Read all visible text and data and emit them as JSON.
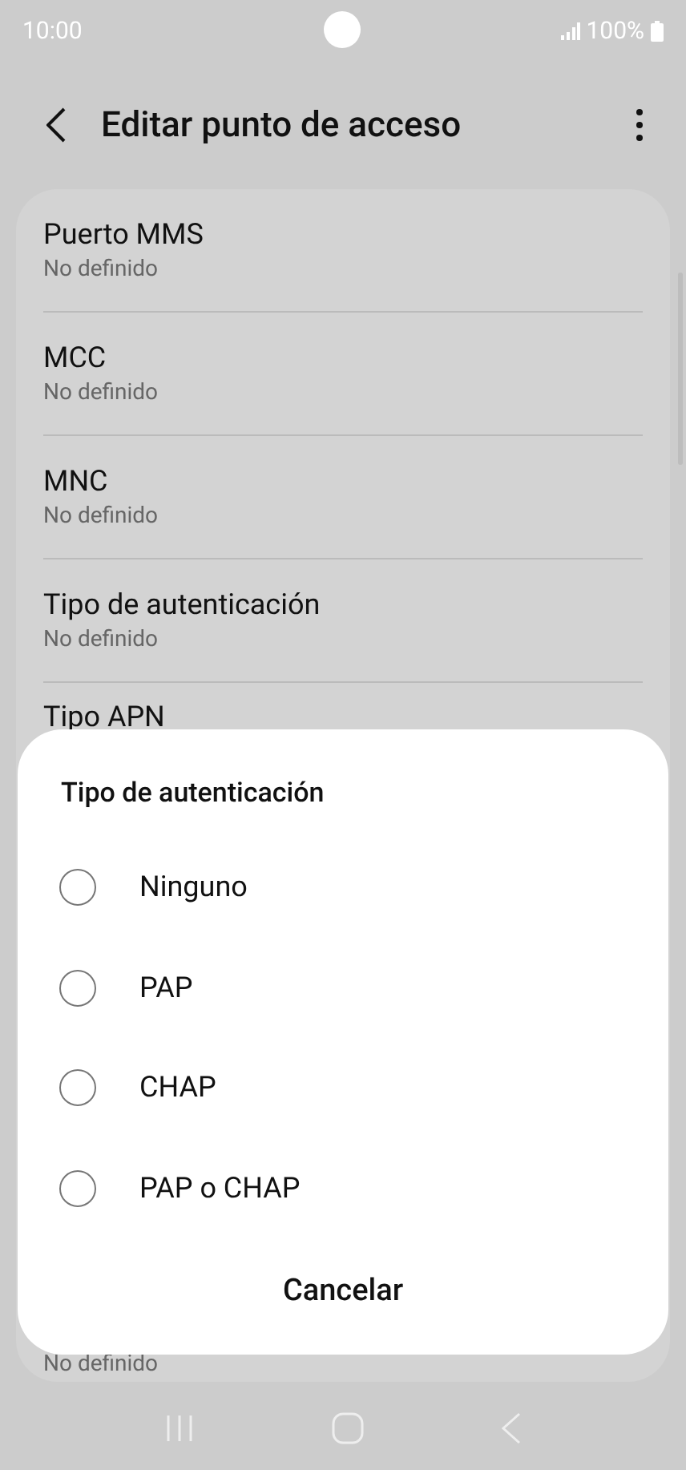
{
  "status_bar": {
    "time": "10:00",
    "battery": "100%"
  },
  "header": {
    "title": "Editar punto de acceso"
  },
  "settings": [
    {
      "title": "Puerto MMS",
      "subtitle": "No definido"
    },
    {
      "title": "MCC",
      "subtitle": "No definido"
    },
    {
      "title": "MNC",
      "subtitle": "No definido"
    },
    {
      "title": "Tipo de autenticación",
      "subtitle": "No definido"
    },
    {
      "title": "Tipo APN"
    }
  ],
  "last_setting": {
    "subtitle": "No definido"
  },
  "dialog": {
    "title": "Tipo de autenticación",
    "options": [
      {
        "label": "Ninguno",
        "selected": false
      },
      {
        "label": "PAP",
        "selected": false
      },
      {
        "label": "CHAP",
        "selected": false
      },
      {
        "label": "PAP o CHAP",
        "selected": false
      }
    ],
    "cancel": "Cancelar"
  }
}
